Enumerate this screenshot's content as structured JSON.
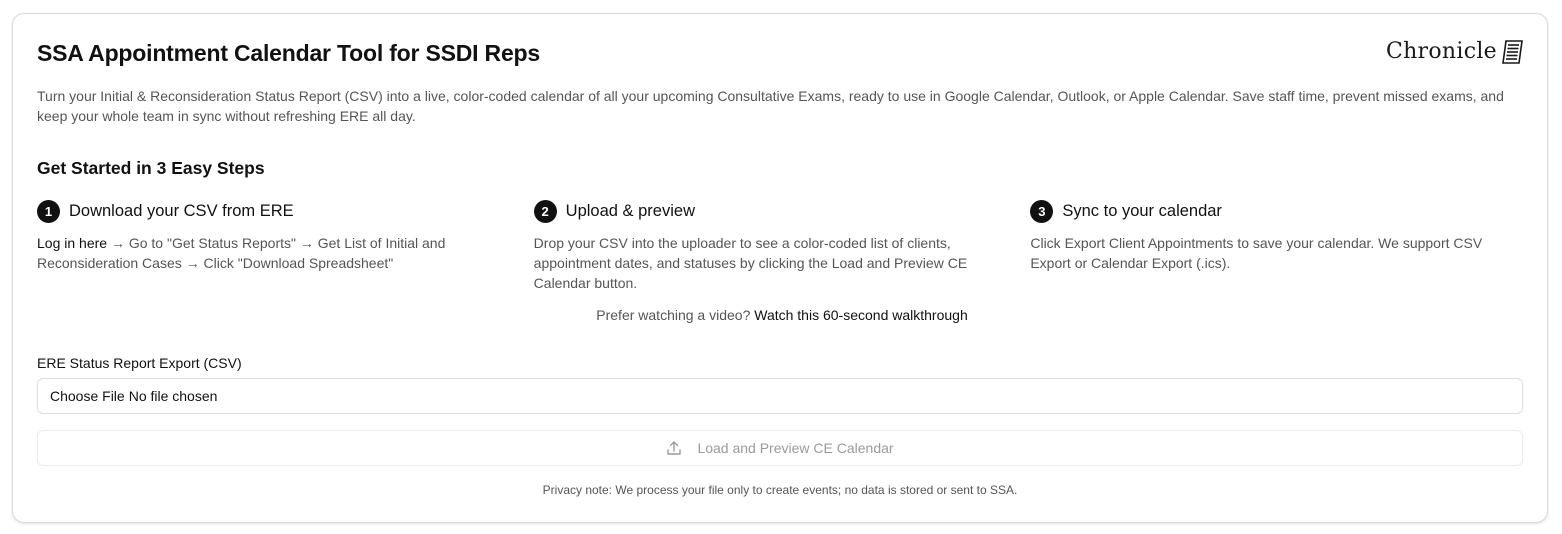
{
  "header": {
    "title": "SSA Appointment Calendar Tool for SSDI Reps",
    "brand": "Chronicle",
    "brand_icon": "document-icon"
  },
  "intro": "Turn your Initial & Reconsideration Status Report (CSV) into a live, color-coded calendar of all your upcoming Consultative Exams, ready to use in Google Calendar, Outlook, or Apple Calendar. Save staff time, prevent missed exams, and keep your whole team in sync without refreshing ERE all day.",
  "steps_section": {
    "title": "Get Started in 3 Easy Steps",
    "steps": [
      {
        "number": "1",
        "title": "Download your CSV from ERE",
        "link": "Log in here",
        "body": " → Go to \"Get Status Reports\" → Get List of Initial and Reconsideration Cases → Click \"Download Spreadsheet\""
      },
      {
        "number": "2",
        "title": "Upload & preview",
        "body": "Drop your CSV into the uploader to see a color-coded list of clients, appointment dates, and statuses by clicking the Load and Preview CE Calendar button."
      },
      {
        "number": "3",
        "title": "Sync to your calendar",
        "body": "Click Export Client Appointments to save your calendar. We support CSV Export or Calendar Export (.ics)."
      }
    ]
  },
  "video": {
    "prefix": "Prefer watching a video? ",
    "link": "Watch this 60-second walkthrough"
  },
  "upload": {
    "label": "ERE Status Report Export (CSV)",
    "choose_file": "Choose File",
    "no_file": "No file chosen",
    "load_button": "Load and Preview CE Calendar",
    "load_icon": "upload-icon"
  },
  "privacy": "Privacy note: We process your file only to create events; no data is stored or sent to SSA.",
  "colors": {
    "text": "#111111",
    "muted": "#555555",
    "disabled": "#9a9a9a",
    "border": "#dcdcdc"
  }
}
